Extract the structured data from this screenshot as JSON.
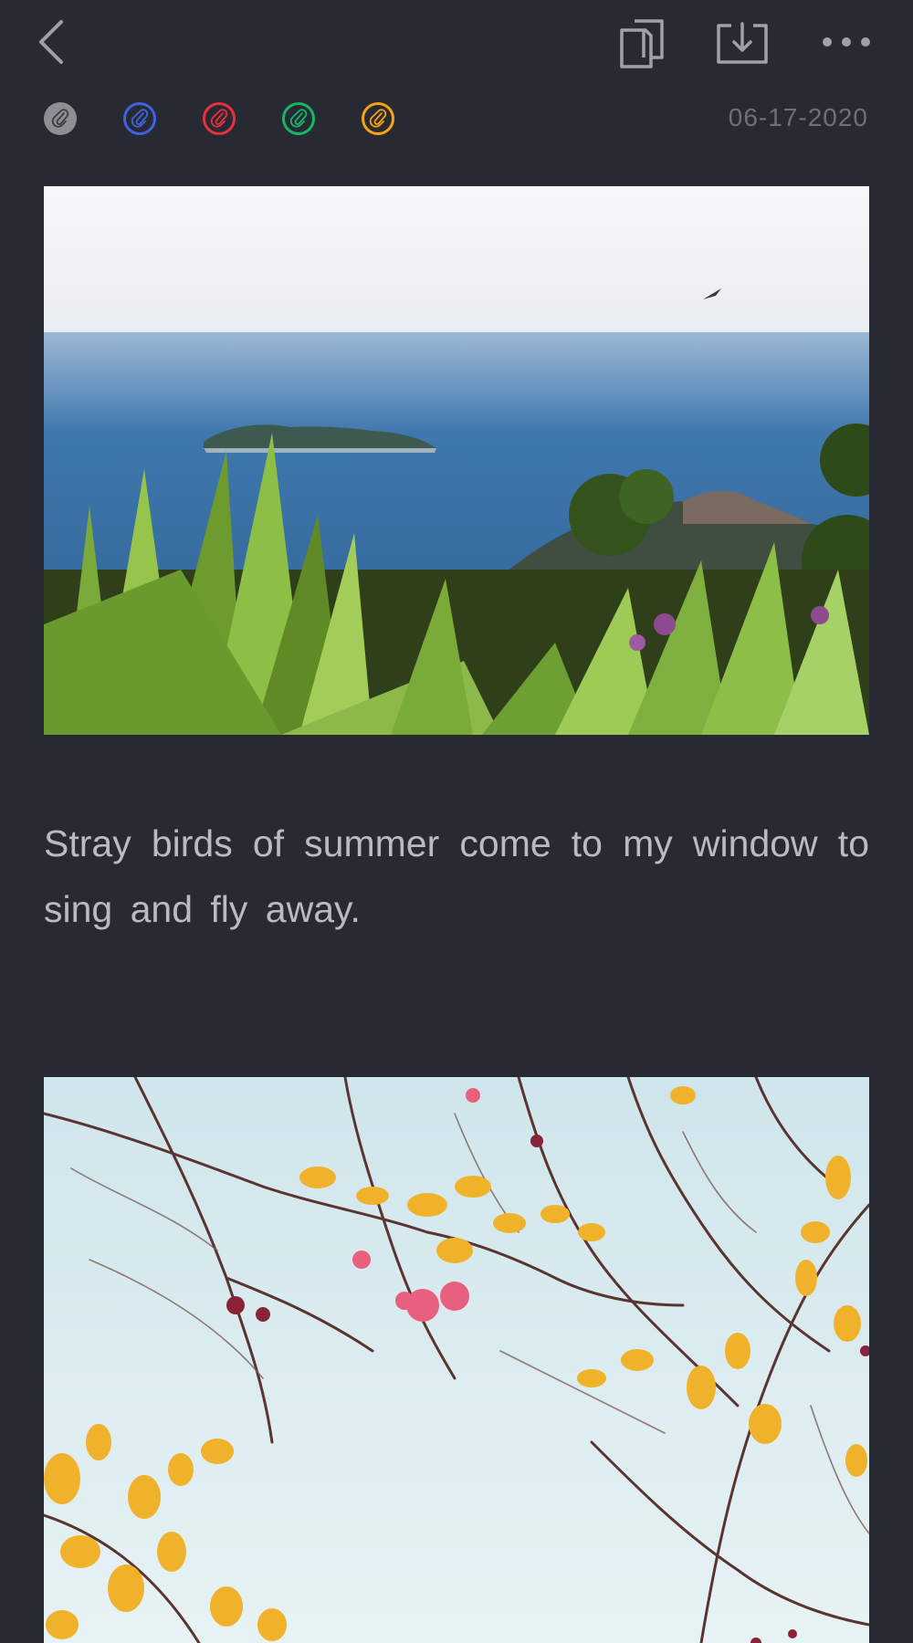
{
  "toolbar": {
    "back_icon": "chevron-left-icon",
    "copy_icon": "copy-icon",
    "download_icon": "download-icon",
    "more_icon": "more-horizontal-icon",
    "icon_color": "#9FA1A8"
  },
  "tags": [
    {
      "name": "gray",
      "color": "#8E8F94",
      "icon": "paperclip-icon"
    },
    {
      "name": "blue",
      "color": "#3F63E0",
      "icon": "paperclip-icon"
    },
    {
      "name": "red",
      "color": "#E8303F",
      "icon": "paperclip-icon"
    },
    {
      "name": "green",
      "color": "#14B863",
      "icon": "paperclip-icon"
    },
    {
      "name": "orange",
      "color": "#F5A310",
      "icon": "paperclip-icon"
    }
  ],
  "note": {
    "date": "06-17-2020",
    "text": "Stray birds of summer come to my window to sing and fly away."
  },
  "theme": {
    "background": "#272A33",
    "text": "#B9BBC3",
    "date": "#6E7078"
  }
}
